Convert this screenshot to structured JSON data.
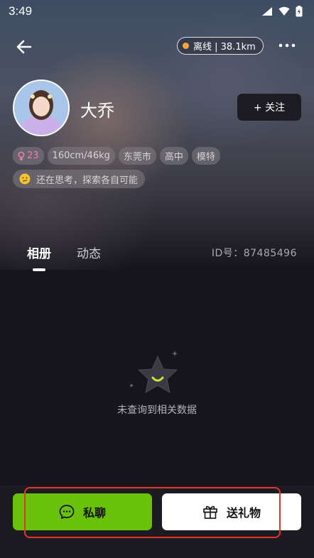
{
  "status_bar": {
    "time": "3:49"
  },
  "header": {
    "online_status": "离线 | 38.1km",
    "status_color": "#f4a73a"
  },
  "profile": {
    "name": "大乔",
    "follow_label": "+ 关注",
    "tags": {
      "age": "23",
      "body": "160cm/46kg",
      "city": "东莞市",
      "education": "高中",
      "job": "模特"
    },
    "mood": "还在思考，探索各自可能"
  },
  "tabs": [
    {
      "label": "相册",
      "active": true
    },
    {
      "label": "动态",
      "active": false
    }
  ],
  "user_id": "ID号：87485496",
  "empty_state": {
    "text": "未查询到相关数据"
  },
  "actions": {
    "chat_label": "私聊",
    "gift_label": "送礼物",
    "chat_color": "#6ac10a",
    "highlight_color": "#e5352b"
  }
}
